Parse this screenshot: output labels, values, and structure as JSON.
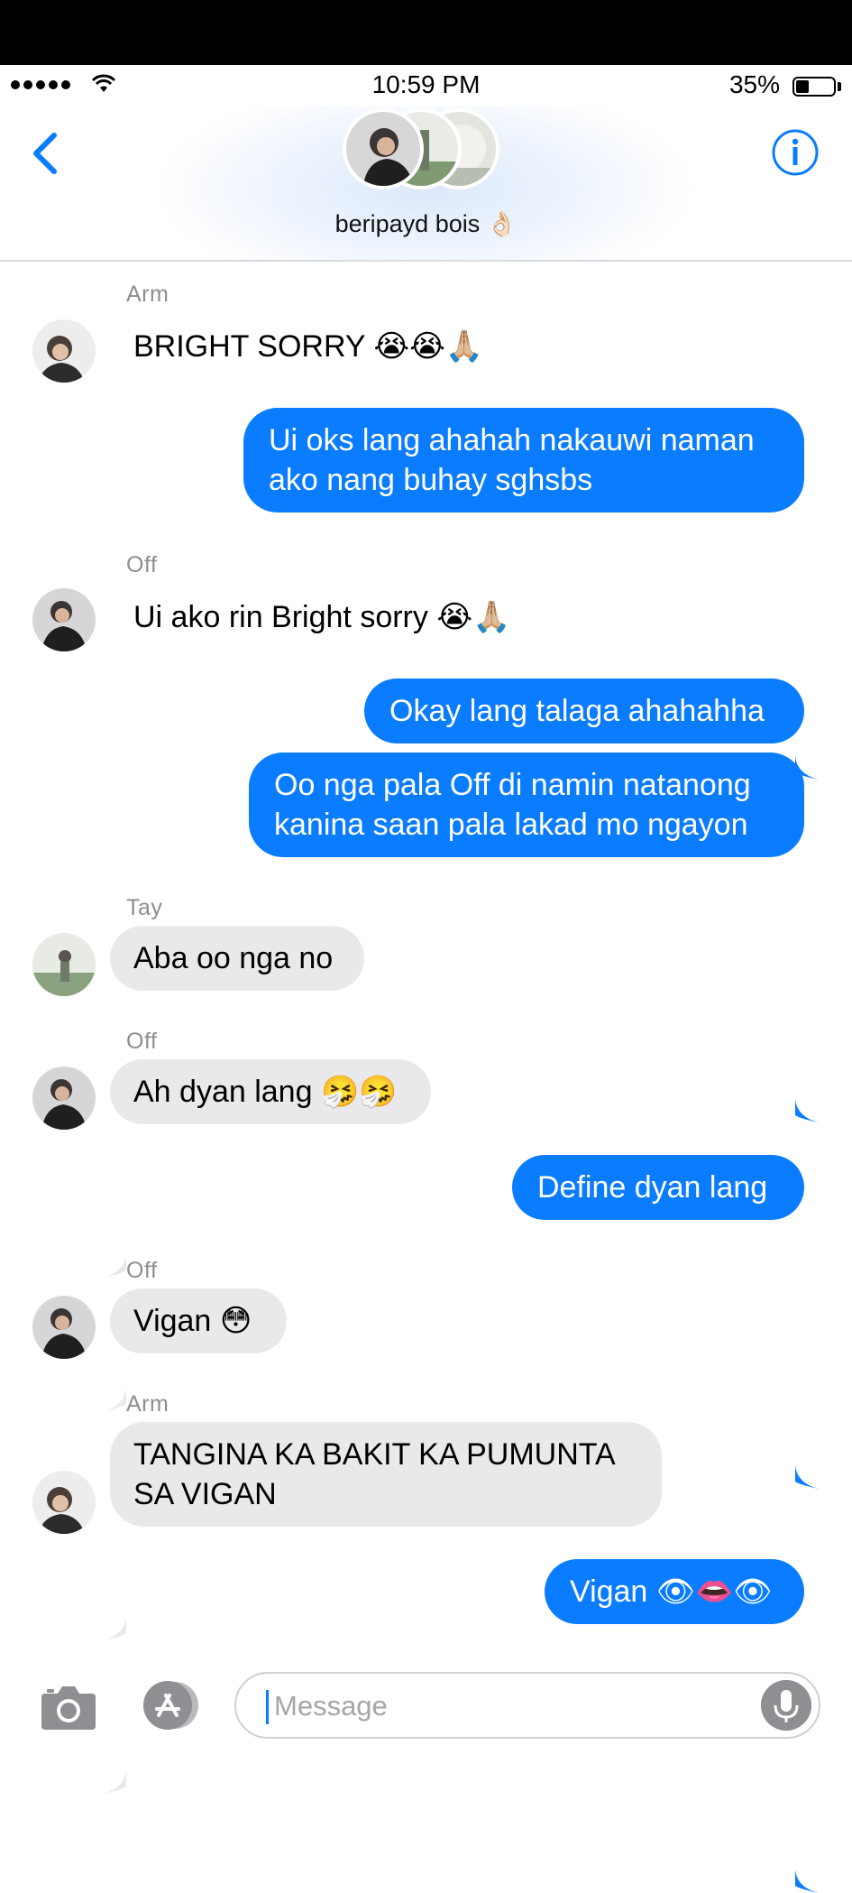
{
  "status": {
    "time": "10:59 PM",
    "battery": "35%"
  },
  "header": {
    "group_name": "beripayd bois",
    "group_emoji": "👌🏻"
  },
  "messages": [
    {
      "sender": "Arm",
      "text": "BRIGHT SORRY",
      "emojis": [
        "😭",
        "😭",
        "🙏🏼"
      ]
    },
    {
      "text": "Ui oks lang ahahah nakauwi naman",
      "text2": "ako nang buhay sghsbs"
    },
    {
      "sender": "Off",
      "text": "Ui ako rin Bright sorry",
      "emojis": [
        "😭",
        "🙏🏼"
      ]
    },
    {
      "text": "Okay lang talaga ahahahha"
    },
    {
      "text": "Oo nga pala Off di namin natanong",
      "text2": "kanina saan pala lakad mo ngayon"
    },
    {
      "sender": "Tay",
      "text": "Aba oo nga no"
    },
    {
      "sender": "Off",
      "text": "Ah dyan lang",
      "emojis": [
        "🤧",
        "🤧"
      ]
    },
    {
      "text": "Define dyan lang"
    },
    {
      "sender": "Off",
      "text": "Vigan",
      "emojis": [
        "😳"
      ]
    },
    {
      "sender": "Arm",
      "text": "TANGINA KA BAKIT KA PUMUNTA",
      "text2": "SA VIGAN"
    },
    {
      "text": "Vigan",
      "emojis": [
        "👁",
        "👄",
        "👁"
      ]
    }
  ],
  "composer": {
    "placeholder": "Message"
  },
  "colors": {
    "blue": "#0a7cff",
    "gray_bubble": "#e9e9eb"
  }
}
